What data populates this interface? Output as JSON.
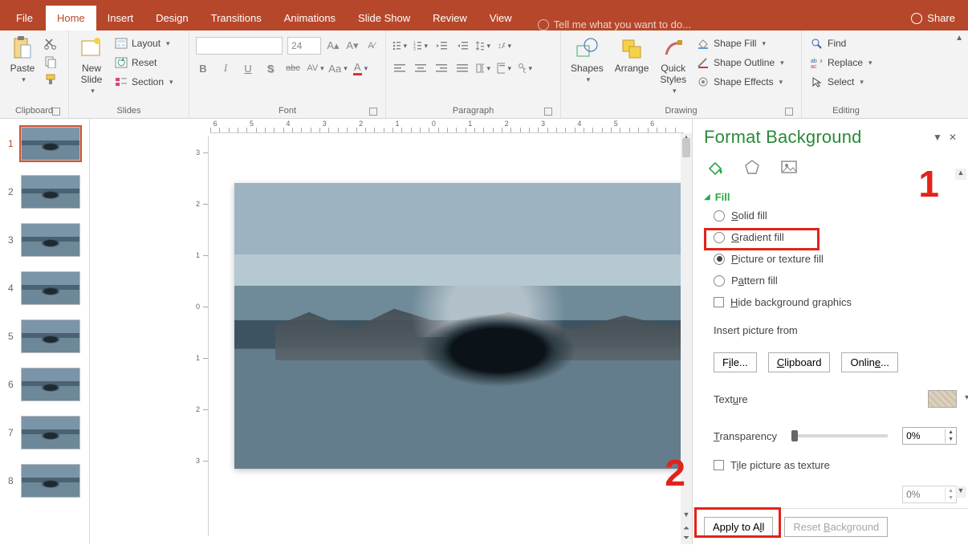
{
  "menubar": {
    "tabs": [
      "File",
      "Home",
      "Insert",
      "Design",
      "Transitions",
      "Animations",
      "Slide Show",
      "Review",
      "View"
    ],
    "active": "Home",
    "tellme": "Tell me what you want to do...",
    "share": "Share"
  },
  "ribbon": {
    "clipboard": {
      "paste": "Paste",
      "cut": "Cut",
      "copy": "Copy",
      "fmt": "Format Painter",
      "label": "Clipboard"
    },
    "slides": {
      "newslide": "New\nSlide",
      "layout": "Layout",
      "reset": "Reset",
      "section": "Section",
      "label": "Slides"
    },
    "font": {
      "name_placeholder": "",
      "size": "24",
      "label": "Font",
      "bold": "B",
      "italic": "I",
      "under": "U",
      "shadow": "S",
      "strike": "abc",
      "spacing": "AV",
      "case": "Aa",
      "color": "A"
    },
    "paragraph": {
      "label": "Paragraph"
    },
    "drawing": {
      "shapes": "Shapes",
      "arrange": "Arrange",
      "quick": "Quick\nStyles",
      "fill": "Shape Fill",
      "outline": "Shape Outline",
      "effects": "Shape Effects",
      "label": "Drawing"
    },
    "editing": {
      "find": "Find",
      "replace": "Replace",
      "select": "Select",
      "label": "Editing"
    }
  },
  "thumbs": {
    "count": 8,
    "selected": 1
  },
  "panel": {
    "title": "Format Background",
    "section": "Fill",
    "options": {
      "solid": "Solid fill",
      "gradient": "Gradient fill",
      "picture": "Picture or texture fill",
      "pattern": "Pattern fill",
      "hide": "Hide background graphics"
    },
    "insert_label": "Insert picture from",
    "buttons": {
      "file": "File...",
      "clipboard": "Clipboard",
      "online": "Online..."
    },
    "texture": "Texture",
    "transparency": {
      "label": "Transparency",
      "value": "0%"
    },
    "tile": "Tile picture as texture",
    "offset": {
      "value": "0%"
    },
    "apply": "Apply to All",
    "reset": "Reset Background",
    "selected_option": "picture"
  },
  "annotations": {
    "one": "1",
    "two": "2"
  },
  "ruler": {
    "h": [
      "6",
      "5",
      "4",
      "3",
      "2",
      "1",
      "0",
      "1",
      "2",
      "3",
      "4",
      "5",
      "6"
    ],
    "v": [
      "3",
      "2",
      "1",
      "0",
      "1",
      "2",
      "3"
    ]
  }
}
